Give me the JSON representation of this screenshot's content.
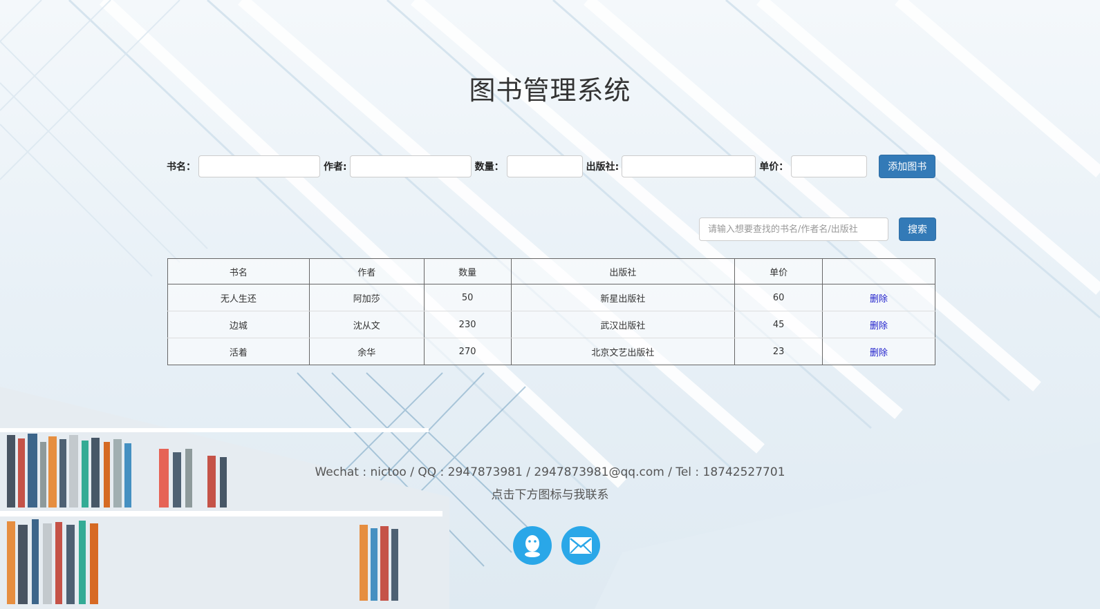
{
  "page": {
    "title": "图书管理系统"
  },
  "add_form": {
    "fields": [
      {
        "label": "书名：",
        "value": ""
      },
      {
        "label": "作者:",
        "value": ""
      },
      {
        "label": "数量：",
        "value": ""
      },
      {
        "label": "出版社:",
        "value": ""
      },
      {
        "label": "单价：",
        "value": ""
      }
    ],
    "submit_label": "添加图书"
  },
  "search": {
    "placeholder": "请输入想要查找的书名/作者名/出版社",
    "value": "",
    "button_label": "搜索"
  },
  "table": {
    "headers": [
      "书名",
      "作者",
      "数量",
      "出版社",
      "单价",
      ""
    ],
    "rows": [
      {
        "name": "无人生还",
        "author": "阿加莎",
        "quantity": "50",
        "publisher": "新星出版社",
        "price": "60",
        "action": "删除"
      },
      {
        "name": "边城",
        "author": "沈从文",
        "quantity": "230",
        "publisher": "武汉出版社",
        "price": "45",
        "action": "删除"
      },
      {
        "name": "活着",
        "author": "余华",
        "quantity": "270",
        "publisher": "北京文艺出版社",
        "price": "23",
        "action": "删除"
      }
    ]
  },
  "footer": {
    "contact_line": "Wechat : nictoo / QQ : 2947873981 / 2947873981@qq.com / Tel : 18742527701",
    "hint": "点击下方图标与我联系",
    "icons": [
      "qq-icon",
      "mail-icon"
    ]
  },
  "colors": {
    "primary_button": "#337ab7",
    "link": "#2222cc",
    "icon_circle": "#2aa7e8"
  }
}
